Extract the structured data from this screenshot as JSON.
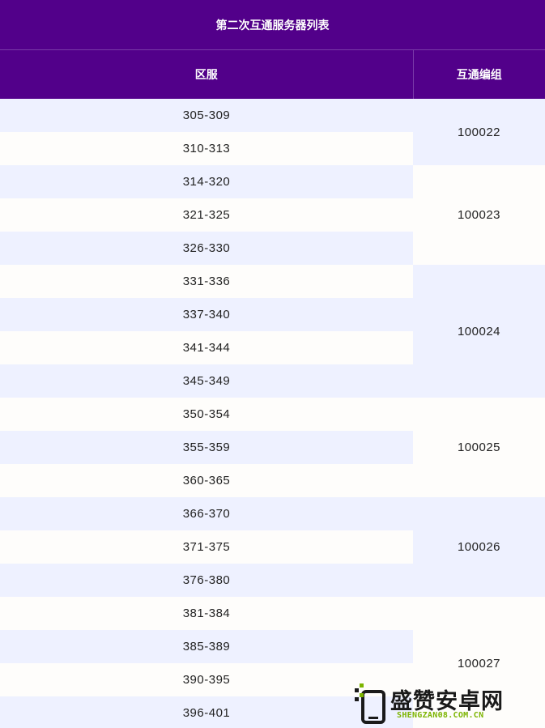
{
  "table": {
    "title": "第二次互通服务器列表",
    "headers": [
      "区服",
      "互通编组"
    ],
    "rows": [
      {
        "range": "305-309"
      },
      {
        "range": "310-313"
      },
      {
        "range": "314-320"
      },
      {
        "range": "321-325"
      },
      {
        "range": "326-330"
      },
      {
        "range": "331-336"
      },
      {
        "range": "337-340"
      },
      {
        "range": "341-344"
      },
      {
        "range": "345-349"
      },
      {
        "range": "350-354"
      },
      {
        "range": "355-359"
      },
      {
        "range": "360-365"
      },
      {
        "range": "366-370"
      },
      {
        "range": "371-375"
      },
      {
        "range": "376-380"
      },
      {
        "range": "381-384"
      },
      {
        "range": "385-389"
      },
      {
        "range": "390-395"
      },
      {
        "range": "396-401"
      }
    ],
    "groups": [
      "100022",
      "100023",
      "100024",
      "100025",
      "100026",
      "100027"
    ]
  },
  "watermark": {
    "brand": "盛赞安卓网",
    "url": "SHENGZAN08.COM.CN"
  },
  "colors": {
    "header_bg": "#52008a",
    "row_shade": "#eef1ff",
    "row_plain": "#fefdfb",
    "watermark_accent": "#7cb400"
  }
}
